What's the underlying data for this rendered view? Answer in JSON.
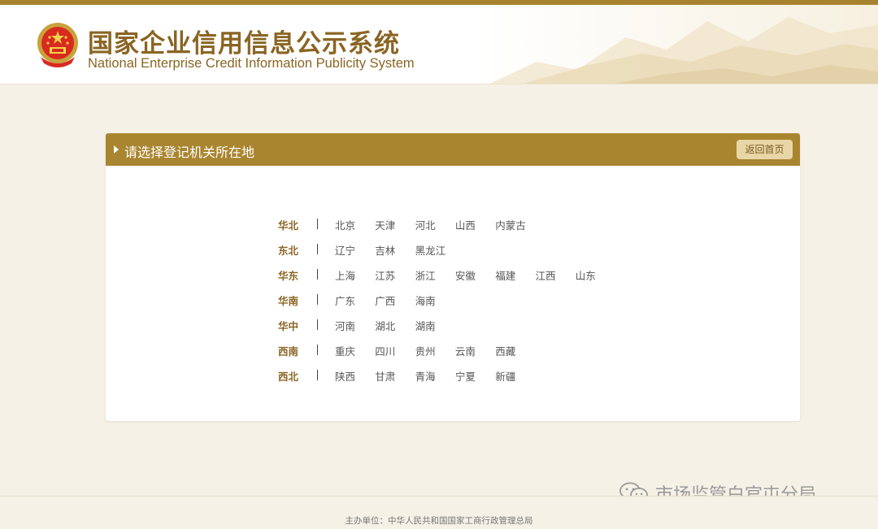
{
  "header": {
    "title_cn": "国家企业信用信息公示系统",
    "title_en": "National Enterprise Credit Information Publicity System"
  },
  "panel": {
    "title": "请选择登记机关所在地",
    "home_button": "返回首页"
  },
  "regions": [
    {
      "name": "华北",
      "provinces": [
        "北京",
        "天津",
        "河北",
        "山西",
        "内蒙古"
      ]
    },
    {
      "name": "东北",
      "provinces": [
        "辽宁",
        "吉林",
        "黑龙江"
      ]
    },
    {
      "name": "华东",
      "provinces": [
        "上海",
        "江苏",
        "浙江",
        "安徽",
        "福建",
        "江西",
        "山东"
      ]
    },
    {
      "name": "华南",
      "provinces": [
        "广东",
        "广西",
        "海南"
      ]
    },
    {
      "name": "华中",
      "provinces": [
        "河南",
        "湖北",
        "湖南"
      ]
    },
    {
      "name": "西南",
      "provinces": [
        "重庆",
        "四川",
        "贵州",
        "云南",
        "西藏"
      ]
    },
    {
      "name": "西北",
      "provinces": [
        "陕西",
        "甘肃",
        "青海",
        "宁夏",
        "新疆"
      ]
    }
  ],
  "footer": {
    "text": "主办单位：中华人民共和国国家工商行政管理总局"
  },
  "watermark": {
    "text": "市场监管白官屯分局"
  },
  "colors": {
    "brand_gold": "#a9852f",
    "title_brown": "#8a6523",
    "button_bg": "#e8d6a6",
    "page_bg": "#f6f1e7"
  }
}
